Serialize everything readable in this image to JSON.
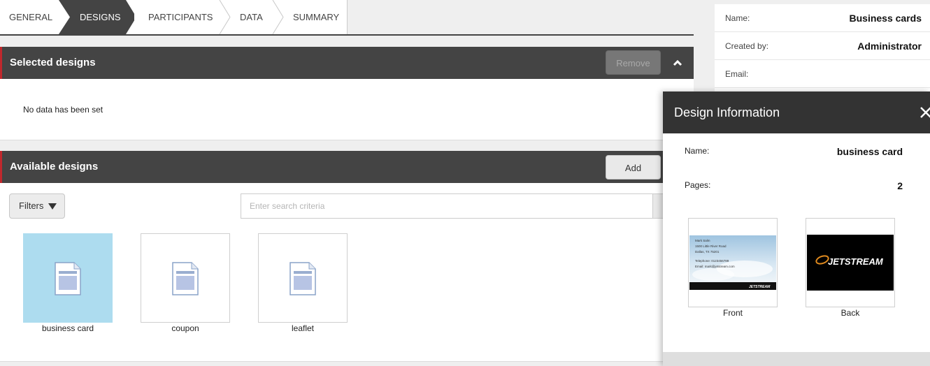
{
  "wizard": {
    "tabs": [
      {
        "label": "GENERAL"
      },
      {
        "label": "DESIGNS"
      },
      {
        "label": "PARTICIPANTS"
      },
      {
        "label": "DATA"
      },
      {
        "label": "SUMMARY"
      }
    ],
    "active_tab": "DESIGNS"
  },
  "selected_designs": {
    "title": "Selected designs",
    "remove_label": "Remove",
    "empty_text": "No data has been set"
  },
  "available_designs": {
    "title": "Available designs",
    "add_label": "Add",
    "filters_label": "Filters",
    "search_placeholder": "Enter search criteria",
    "items": [
      {
        "label": "business card",
        "selected": true
      },
      {
        "label": "coupon",
        "selected": false
      },
      {
        "label": "leaflet",
        "selected": false
      }
    ]
  },
  "info_panel": {
    "rows": [
      {
        "key": "Name:",
        "value": "Business cards"
      },
      {
        "key": "Created by:",
        "value": "Administrator"
      },
      {
        "key": "Email:",
        "value": ""
      }
    ]
  },
  "design_info": {
    "title": "Design Information",
    "name_key": "Name:",
    "name_value": "business card",
    "pages_key": "Pages:",
    "pages_value": "2",
    "pages": [
      {
        "caption": "Front",
        "card_lines": [
          "Mark Salm",
          "1500 Little River Road",
          "Dallas, TX 75201",
          "Telephone: 0123456789",
          "Email: mark@jetstream.com"
        ],
        "logo_text": "JETSTREAM"
      },
      {
        "caption": "Back",
        "logo_text": "JETSTREAM"
      }
    ]
  },
  "colors": {
    "header_bg": "#444444",
    "accent_red": "#c0282d",
    "selected_thumb": "#addcef",
    "dialog_header": "#333333"
  }
}
